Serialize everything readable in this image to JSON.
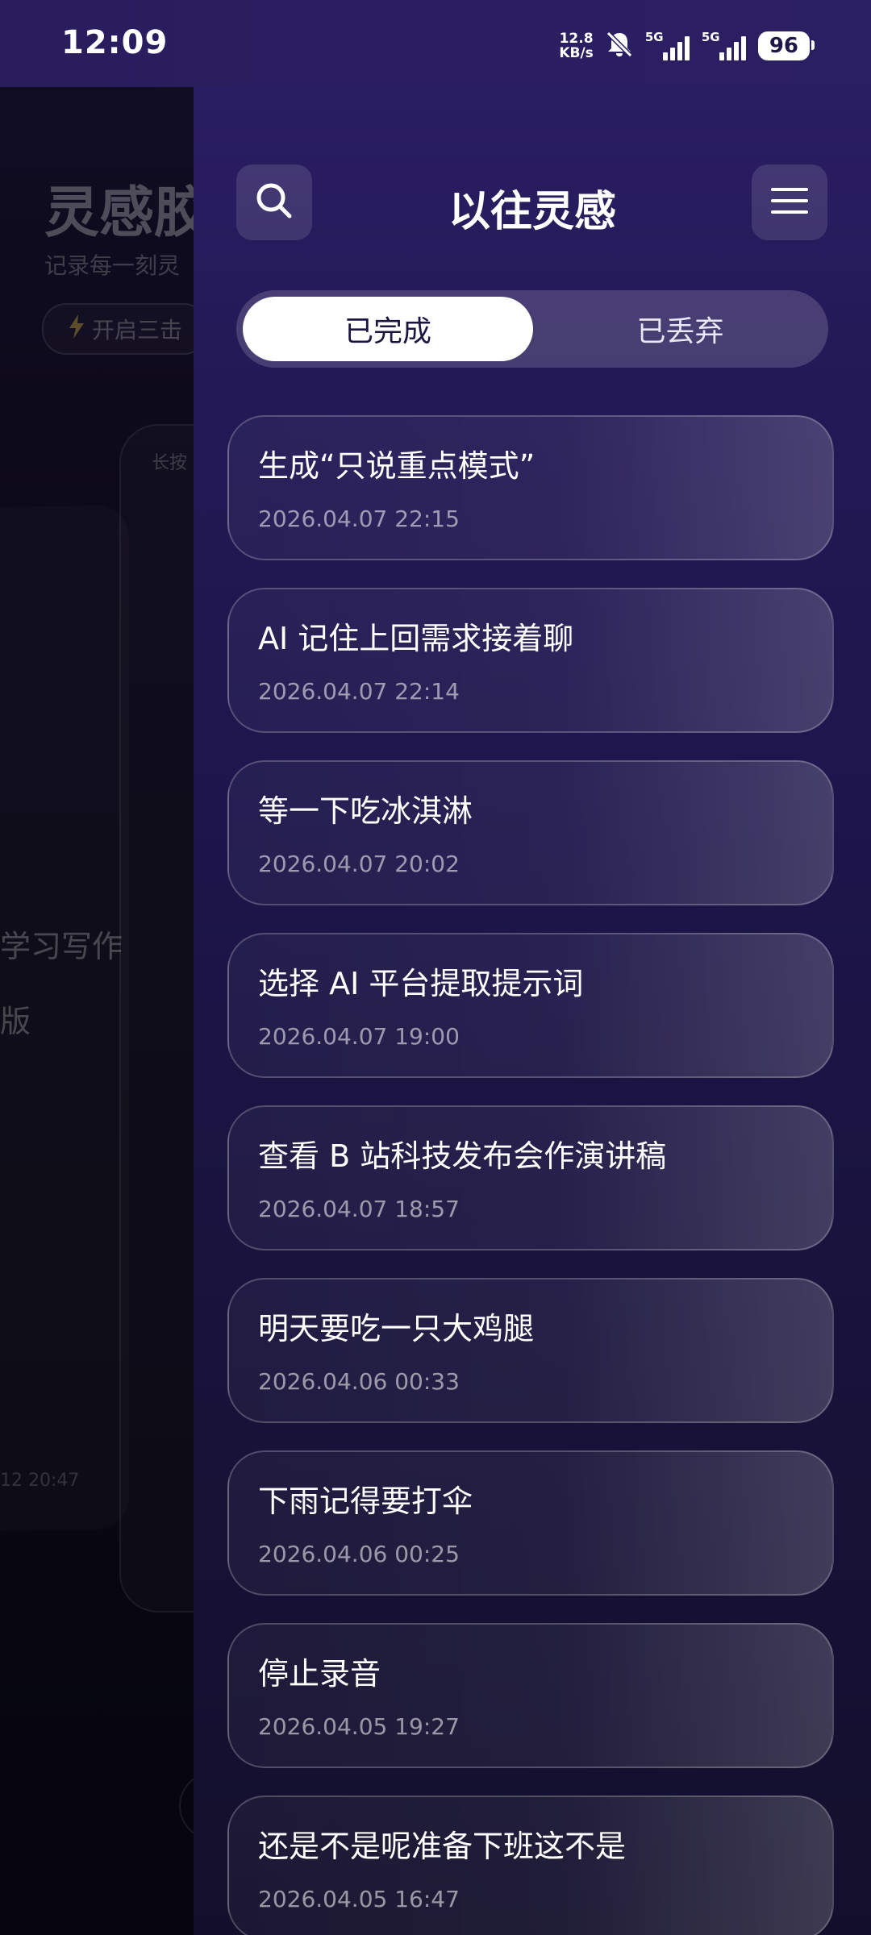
{
  "status_bar": {
    "time": "12:09",
    "net_speed_value": "12.8",
    "net_speed_unit": "KB/s",
    "sim1_label": "5G",
    "sim2_label": "5G",
    "battery": "96"
  },
  "background_app": {
    "title": "灵感胶",
    "subtitle": "记录每一刻灵",
    "chip_label": "开启三击",
    "card_hint": "长按",
    "text_line1": "学习写作",
    "text_line2": "版",
    "timestamp": "12 20:47"
  },
  "drawer": {
    "title": "以往灵感",
    "tabs": [
      {
        "label": "已完成",
        "active": true
      },
      {
        "label": "已丢弃",
        "active": false
      }
    ],
    "items": [
      {
        "title": "生成“只说重点模式”",
        "time": "2026.04.07 22:15"
      },
      {
        "title": "AI 记住上回需求接着聊",
        "time": "2026.04.07 22:14"
      },
      {
        "title": "等一下吃冰淇淋",
        "time": "2026.04.07 20:02"
      },
      {
        "title": "选择 AI 平台提取提示词",
        "time": "2026.04.07 19:00"
      },
      {
        "title": "查看 B 站科技发布会作演讲稿",
        "time": "2026.04.07 18:57"
      },
      {
        "title": "明天要吃一只大鸡腿",
        "time": "2026.04.06 00:33"
      },
      {
        "title": "下雨记得要打伞",
        "time": "2026.04.06 00:25"
      },
      {
        "title": "停止录音",
        "time": "2026.04.05 19:27"
      },
      {
        "title": "还是不是呢准备下班这不是",
        "time": "2026.04.05 16:47"
      }
    ]
  },
  "colors": {
    "drawer_top": "#2c1f66",
    "drawer_bottom": "#130f2b",
    "segment_active_bg": "#ffffff",
    "text_primary": "#ffffff"
  },
  "icons": {
    "search": "search-icon",
    "menu": "hamburger-menu-icon",
    "mute": "bell-off-icon",
    "lightning": "lightning-icon"
  }
}
